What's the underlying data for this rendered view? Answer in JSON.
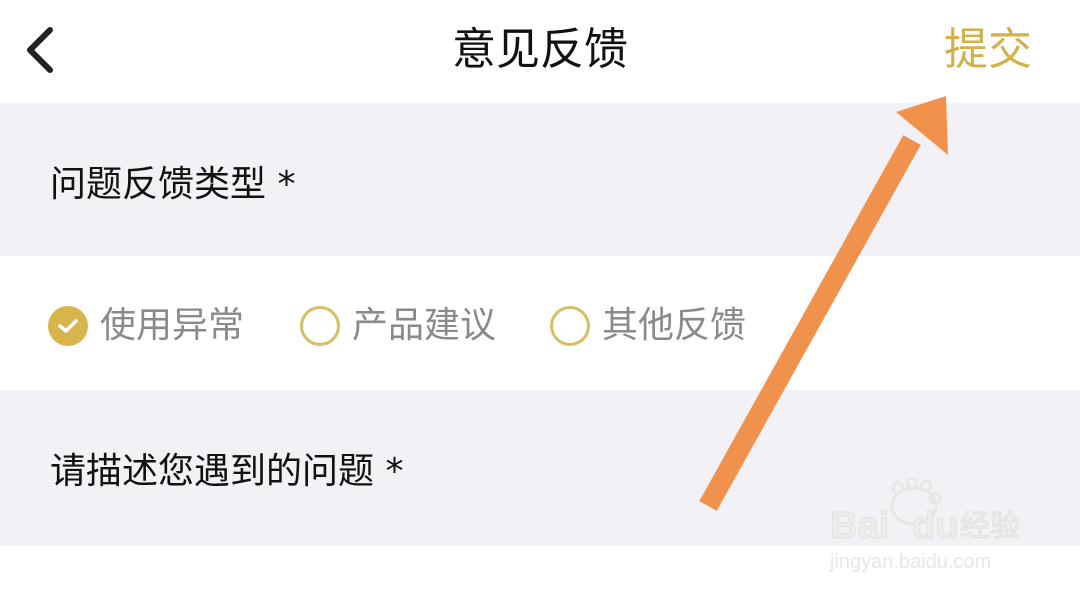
{
  "header": {
    "title": "意见反馈",
    "submit_label": "提交"
  },
  "feedback_type": {
    "label": "问题反馈类型 *",
    "options": [
      {
        "label": "使用异常",
        "checked": true
      },
      {
        "label": "产品建议",
        "checked": false
      },
      {
        "label": "其他反馈",
        "checked": false
      }
    ]
  },
  "description": {
    "label": "请描述您遇到的问题 *"
  },
  "watermark": {
    "brand": "Bai du 经验",
    "url": "jingyan.baidu.com"
  },
  "colors": {
    "accent": "#d2b14a",
    "section_bg": "#f2f2f6",
    "arrow": "#f0924c"
  }
}
